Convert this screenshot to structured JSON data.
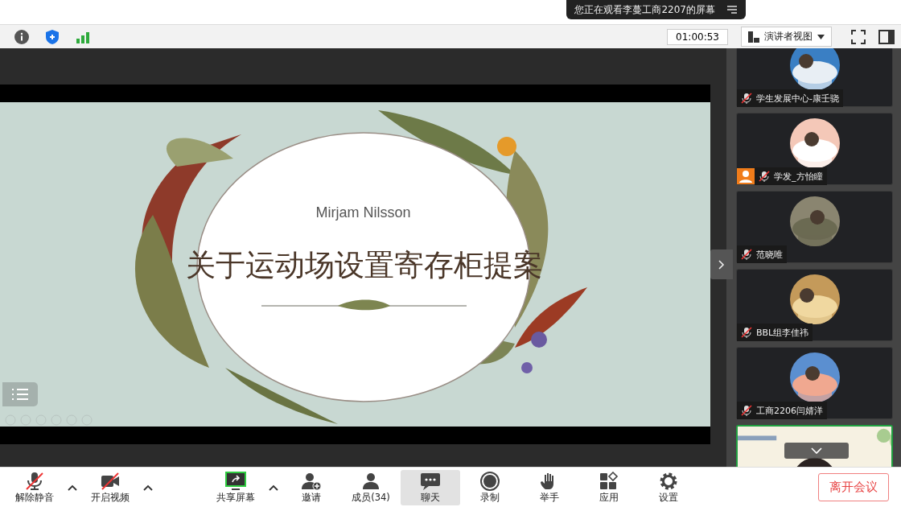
{
  "banner": {
    "text": "您正在观看李蔓工商2207的屏幕"
  },
  "toolbar": {
    "timer": "01:00:53",
    "view_label": "演讲者视图"
  },
  "slide": {
    "author": "Mirjam Nilsson",
    "title": "关于运动场设置寄存柜提案"
  },
  "participants": [
    {
      "kind": "avatar",
      "name": "学生发展中心-康壬骁",
      "muted": true,
      "host_badge": false,
      "speaking": false
    },
    {
      "kind": "avatar",
      "name": "学发_方怡瞳",
      "muted": true,
      "host_badge": true,
      "speaking": false
    },
    {
      "kind": "avatar",
      "name": "范晓唯",
      "muted": true,
      "host_badge": false,
      "speaking": false
    },
    {
      "kind": "avatar",
      "name": "BBL组李佳祎",
      "muted": true,
      "host_badge": false,
      "speaking": false
    },
    {
      "kind": "avatar",
      "name": "工商2206闫婧洋",
      "muted": true,
      "host_badge": false,
      "speaking": false
    },
    {
      "kind": "video",
      "speaking": true
    }
  ],
  "controls": [
    {
      "kind": "mic",
      "label": "解除静音",
      "off": true,
      "caret": true,
      "selected": false
    },
    {
      "kind": "camera",
      "label": "开启视频",
      "off": true,
      "caret": true,
      "selected": false
    },
    {
      "kind": "share",
      "label": "共享屏幕",
      "off": false,
      "caret": true,
      "selected": false
    },
    {
      "kind": "invite",
      "label": "邀请",
      "off": false,
      "caret": false,
      "selected": false
    },
    {
      "kind": "members",
      "label": "成员(34)",
      "off": false,
      "caret": false,
      "selected": false
    },
    {
      "kind": "chat",
      "label": "聊天",
      "off": false,
      "caret": false,
      "selected": true
    },
    {
      "kind": "record",
      "label": "录制",
      "off": false,
      "caret": false,
      "selected": false
    },
    {
      "kind": "hand",
      "label": "举手",
      "off": false,
      "caret": false,
      "selected": false
    },
    {
      "kind": "apps",
      "label": "应用",
      "off": false,
      "caret": false,
      "selected": false
    },
    {
      "kind": "settings",
      "label": "设置",
      "off": false,
      "caret": false,
      "selected": false
    }
  ],
  "leave_button": "离开会议"
}
